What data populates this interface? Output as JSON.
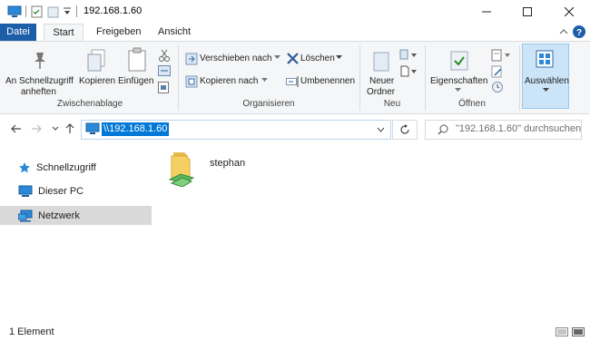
{
  "window": {
    "title": "192.168.1.60",
    "minimize": "—",
    "maximize": "☐",
    "close": "✕"
  },
  "ribbon_tabs": {
    "file": "Datei",
    "start": "Start",
    "share": "Freigeben",
    "view": "Ansicht"
  },
  "ribbon": {
    "pin_line1": "An Schnellzugriff",
    "pin_line2": "anheften",
    "copy": "Kopieren",
    "paste": "Einfügen",
    "clipboard_group": "Zwischenablage",
    "move_to": "Verschieben nach",
    "copy_to": "Kopieren nach",
    "delete": "Löschen",
    "rename": "Umbenennen",
    "organize_group": "Organisieren",
    "new_folder_line1": "Neuer",
    "new_folder_line2": "Ordner",
    "new_group": "Neu",
    "properties": "Eigenschaften",
    "open_group": "Öffnen",
    "select": "Auswählen"
  },
  "address": {
    "path": "\\\\192.168.1.60",
    "search_placeholder": "\"192.168.1.60\" durchsuchen"
  },
  "nav_pane": {
    "quick_access": "Schnellzugriff",
    "this_pc": "Dieser PC",
    "network": "Netzwerk"
  },
  "content": {
    "items": [
      {
        "name": "stephan",
        "type": "shared-folder"
      }
    ]
  },
  "status": {
    "count": "1 Element"
  },
  "colors": {
    "accent": "#0078d7",
    "file_tab": "#1c5ea8",
    "selected_nav": "#d9d9d9"
  }
}
